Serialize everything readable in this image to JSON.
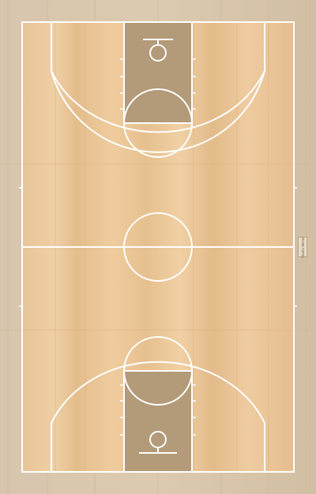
{
  "court": {
    "lines_color": "#ffffff",
    "floor_light": "#ecc89a",
    "floor_mid": "#e2b886",
    "paint_color": "#b39a78",
    "border_wood": "#d8c3a4"
  },
  "watermark": {
    "text": "Studio Vector"
  }
}
